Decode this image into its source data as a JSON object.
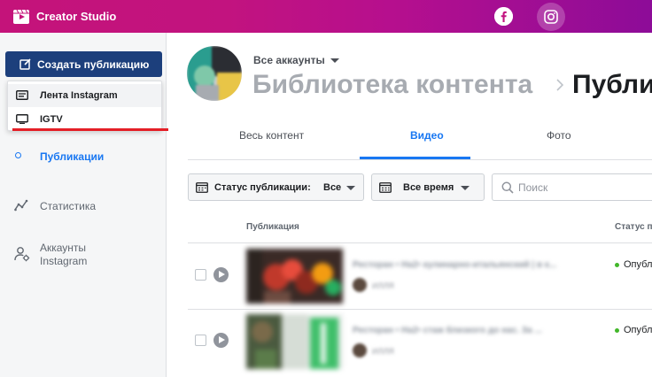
{
  "topbar": {
    "app_title": "Creator Studio",
    "facebook_icon": "facebook-icon",
    "instagram_icon": "instagram-icon"
  },
  "sidebar": {
    "create_button_label": "Создать публикацию",
    "dropdown": [
      {
        "label": "Лента Instagram",
        "icon": "feed-icon"
      },
      {
        "label": "IGTV",
        "icon": "tv-icon"
      }
    ],
    "nav": [
      {
        "label": "Публикации",
        "active": true
      },
      {
        "label": "Статистика",
        "icon": "chart-icon"
      },
      {
        "label_line1": "Аккаунты",
        "label_line2": "Instagram",
        "icon": "accounts-icon"
      }
    ]
  },
  "header": {
    "account_switch": "Все аккаунты",
    "breadcrumb_root": "Библиотека контента",
    "breadcrumb_current": "Публи"
  },
  "tabs": [
    {
      "label": "Весь контент"
    },
    {
      "label": "Видео",
      "active": true
    },
    {
      "label": "Фото"
    }
  ],
  "filters": {
    "status_label": "Статус публикации:",
    "status_value": "Все",
    "time_label": "Все время",
    "search_placeholder": "Поиск"
  },
  "table": {
    "headers": [
      "Публикация",
      "Статус п"
    ],
    "rows": [
      {
        "title": "Ресторан • На2• кулинарно-итальянский | в к...",
        "author": "ИЛЛЯ",
        "status": "Опубл"
      },
      {
        "title": "Ресторан • На2• стаж близкого до нас. За ...",
        "author": "ИЛЛЯ",
        "status": "Опубл"
      }
    ]
  },
  "colors": {
    "accent": "#1877f2",
    "primary_button": "#1c3f7c",
    "underline_red": "#e41e26",
    "status_green": "#42b72a"
  }
}
